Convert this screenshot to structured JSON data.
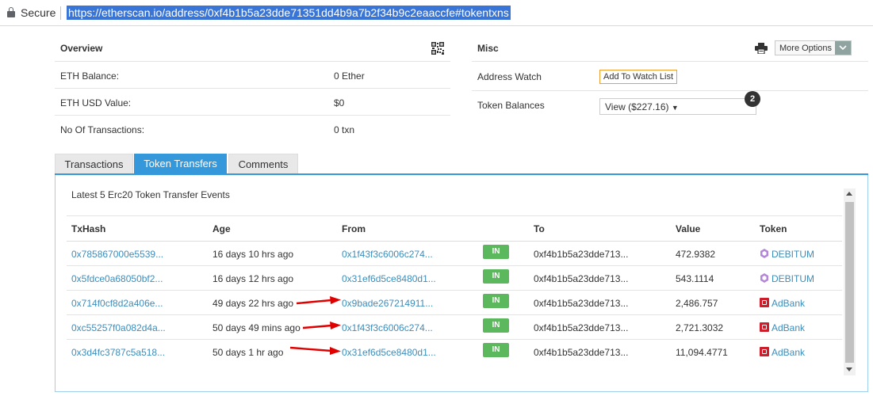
{
  "browser": {
    "secure_label": "Secure",
    "url": "https://etherscan.io/address/0xf4b1b5a23dde71351dd4b9a7b2f34b9c2eaaccfe#tokentxns",
    "icons": {
      "lock": "lock-icon"
    }
  },
  "overview": {
    "title": "Overview",
    "rows": [
      {
        "label": "ETH Balance:",
        "value": "0 Ether"
      },
      {
        "label": "ETH USD Value:",
        "value": "$0"
      },
      {
        "label": "No Of Transactions:",
        "value": "0 txn"
      }
    ],
    "icons": {
      "qr": "qr-code-icon"
    }
  },
  "misc": {
    "title": "Misc",
    "more_options_label": "More Options",
    "address_watch_label": "Address Watch",
    "add_watch_button": "Add To Watch List",
    "token_balances_label": "Token Balances",
    "token_balances_select": "View ($227.16)",
    "token_count_badge": "2",
    "icons": {
      "printer": "printer-icon",
      "caret": "chevron-down-icon"
    }
  },
  "tabs": [
    {
      "label": "Transactions",
      "active": false
    },
    {
      "label": "Token Transfers",
      "active": true
    },
    {
      "label": "Comments",
      "active": false
    }
  ],
  "token_transfers": {
    "heading": "Latest 5 Erc20 Token Transfer Events",
    "columns": [
      "TxHash",
      "Age",
      "From",
      "",
      "To",
      "Value",
      "Token"
    ],
    "direction_label": "IN",
    "rows": [
      {
        "txhash": "0x785867000e5539...",
        "age": "16 days 10 hrs ago",
        "from": "0x1f43f3c6006c274...",
        "direction": "IN",
        "to": "0xf4b1b5a23dde713...",
        "value": "472.9382",
        "token": "DEBITUM"
      },
      {
        "txhash": "0x5fdce0a68050bf2...",
        "age": "16 days 12 hrs ago",
        "from": "0x31ef6d5ce8480d1...",
        "direction": "IN",
        "to": "0xf4b1b5a23dde713...",
        "value": "543.1114",
        "token": "DEBITUM"
      },
      {
        "txhash": "0x714f0cf8d2a406e...",
        "age": "49 days 22 hrs ago",
        "from": "0x9bade267214911...",
        "direction": "IN",
        "to": "0xf4b1b5a23dde713...",
        "value": "2,486.757",
        "token": "AdBank"
      },
      {
        "txhash": "0xc55257f0a082d4a...",
        "age": "50 days 49 mins ago",
        "from": "0x1f43f3c6006c274...",
        "direction": "IN",
        "to": "0xf4b1b5a23dde713...",
        "value": "2,721.3032",
        "token": "AdBank"
      },
      {
        "txhash": "0x3d4fc3787c5a518...",
        "age": "50 days 1 hr ago",
        "from": "0x31ef6d5ce8480d1...",
        "direction": "IN",
        "to": "0xf4b1b5a23dde713...",
        "value": "11,094.4771",
        "token": "AdBank"
      }
    ]
  },
  "colors": {
    "link": "#3c8dbc",
    "tab_active": "#3498db",
    "in_badge": "#5cb85c",
    "annotation_arrow": "#e00000",
    "watch_button_border": "#f0a030"
  }
}
